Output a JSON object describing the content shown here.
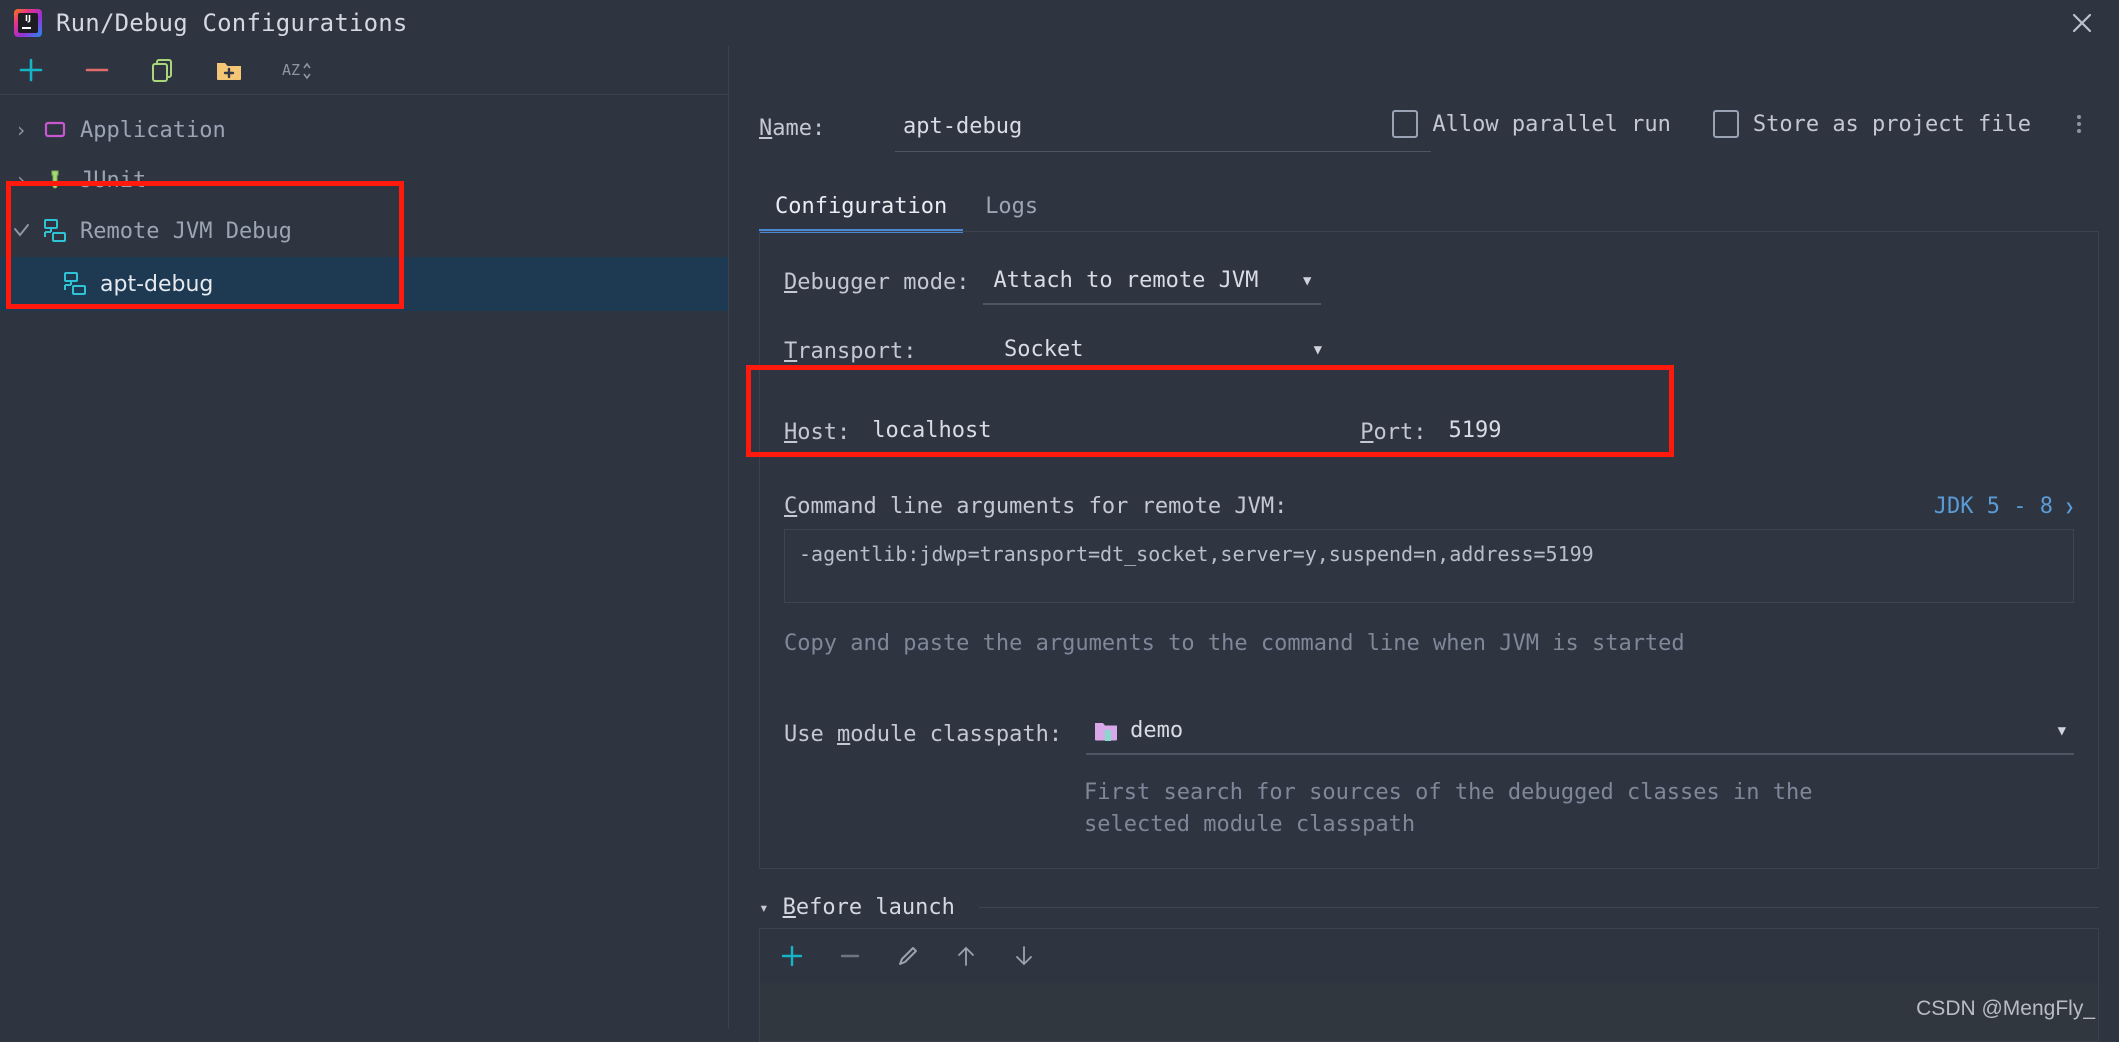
{
  "window": {
    "title": "Run/Debug Configurations",
    "app_icon": "intellij-idea-logo",
    "close_icon": "close-icon"
  },
  "sidebar": {
    "toolbar": [
      {
        "name": "add-configuration-button",
        "icon": "plus-icon",
        "label": "+"
      },
      {
        "name": "remove-configuration-button",
        "icon": "minus-icon",
        "label": "−"
      },
      {
        "name": "copy-configuration-button",
        "icon": "copy-icon",
        "label": ""
      },
      {
        "name": "new-folder-button",
        "icon": "folder-plus-icon",
        "label": ""
      },
      {
        "name": "sort-configurations-button",
        "icon": "sort-alphabetically-icon",
        "label": "AZ"
      }
    ],
    "tree": [
      {
        "label": "Application",
        "icon": "application-icon",
        "expanded": false,
        "arrow": "›",
        "level": 0,
        "selected": false
      },
      {
        "label": "JUnit",
        "icon": "junit-icon",
        "expanded": false,
        "arrow": "›",
        "level": 0,
        "selected": false
      },
      {
        "label": "Remote JVM Debug",
        "icon": "remote-jvm-debug-icon",
        "expanded": true,
        "arrow": "⌄",
        "level": 0,
        "selected": false
      },
      {
        "label": "apt-debug",
        "icon": "remote-jvm-debug-icon",
        "expanded": false,
        "arrow": "",
        "level": 1,
        "selected": true
      }
    ]
  },
  "details": {
    "name_label": "Name:",
    "name_value": "apt-debug",
    "allow_parallel_run": {
      "label": "Allow parallel run",
      "checked": false
    },
    "store_as_project_file": {
      "label": "Store as project file",
      "checked": false
    },
    "options_menu_icon": "kebab-menu-icon",
    "tabs": [
      {
        "label": "Configuration",
        "active": true
      },
      {
        "label": "Logs",
        "active": false
      }
    ],
    "debugger_mode": {
      "label": "Debugger mode:",
      "value": "Attach to remote JVM"
    },
    "transport": {
      "label": "Transport:",
      "value": "Socket"
    },
    "host": {
      "label": "Host:",
      "value": "localhost"
    },
    "port": {
      "label": "Port:",
      "value": "5199"
    },
    "command_line": {
      "label": "Command line arguments for remote JVM:",
      "jdk_selector": "JDK 5 - 8",
      "value": "-agentlib:jdwp=transport=dt_socket,server=y,suspend=n,address=5199",
      "hint": "Copy and paste the arguments to the command line when JVM is started"
    },
    "module_classpath": {
      "label": "Use module classpath:",
      "value": "demo",
      "icon": "module-folder-icon",
      "hint": "First search for sources of the debugged classes in the selected module classpath"
    },
    "before_launch": {
      "title": "Before launch",
      "expanded": true,
      "toolbar": [
        {
          "name": "before-launch-add-button",
          "icon": "plus-icon",
          "label": "+"
        },
        {
          "name": "before-launch-remove-button",
          "icon": "minus-icon",
          "label": "−"
        },
        {
          "name": "before-launch-edit-button",
          "icon": "pencil-icon",
          "label": ""
        },
        {
          "name": "before-launch-move-up-button",
          "icon": "arrow-up-icon",
          "label": "↑"
        },
        {
          "name": "before-launch-move-down-button",
          "icon": "arrow-down-icon",
          "label": "↓"
        }
      ]
    }
  },
  "annotations": {
    "highlight_color": "#ff1a0d",
    "boxes": [
      "remote-jvm-debug-tree-group",
      "host-port-fields"
    ]
  },
  "watermark": "CSDN @MengFly_"
}
